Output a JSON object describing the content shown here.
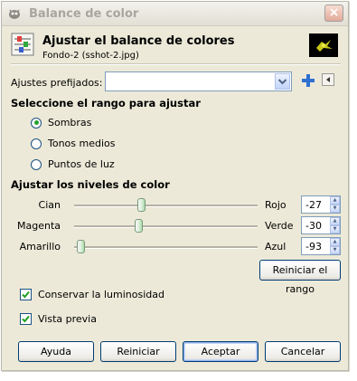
{
  "window": {
    "title": "Balance de color",
    "close_label": "×"
  },
  "header": {
    "title": "Ajustar el balance de colores",
    "subtitle": "Fondo-2 (sshot-2.jpg)"
  },
  "presets": {
    "label": "Ajustes prefijados:",
    "value": ""
  },
  "range": {
    "title": "Seleccione el rango para ajustar",
    "options": [
      {
        "label": "Sombras",
        "selected": true
      },
      {
        "label": "Tonos medios",
        "selected": false
      },
      {
        "label": "Puntos de luz",
        "selected": false
      }
    ]
  },
  "levels": {
    "title": "Ajustar los niveles de color",
    "rows": [
      {
        "left": "Cian",
        "right": "Rojo",
        "value": "-27",
        "level": -27
      },
      {
        "left": "Magenta",
        "right": "Verde",
        "value": "-30",
        "level": -30
      },
      {
        "left": "Amarillo",
        "right": "Azul",
        "value": "-93",
        "level": -93
      }
    ],
    "reset_range_label": "Reiniciar el rango"
  },
  "options": {
    "preserve_luminosity": {
      "label": "Conservar la luminosidad",
      "checked": true
    },
    "preview": {
      "label": "Vista previa",
      "checked": true
    }
  },
  "buttons": {
    "help": "Ayuda",
    "reset": "Reiniciar",
    "ok": "Aceptar",
    "cancel": "Cancelar"
  },
  "colors": {
    "accent_green": "#26a12f",
    "border_blue": "#003c74",
    "window_bg": "#ece9d8"
  }
}
